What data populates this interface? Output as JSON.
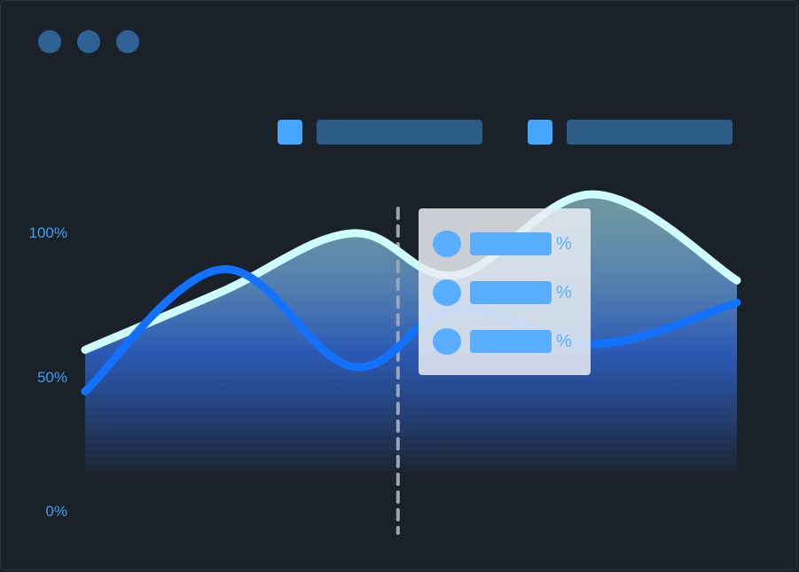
{
  "colors": {
    "background": "#1b2129",
    "window_dots": "#2e6294",
    "legend_swatch": "#46a6ff",
    "legend_bar": "#2b5b87",
    "axis_label": "#3fa0ef",
    "series_light": "#cffcff",
    "series_blue": "#1272ff",
    "tooltip_item": "#5aaeff"
  },
  "window": {
    "dots": [
      "window-dot",
      "window-dot",
      "window-dot"
    ]
  },
  "legend": {
    "items": [
      {
        "swatch": "legend-swatch"
      },
      {
        "swatch": "legend-swatch"
      }
    ]
  },
  "tooltip": {
    "rows": [
      {
        "suffix": "%"
      },
      {
        "suffix": "%"
      },
      {
        "suffix": "%"
      }
    ]
  },
  "chart_data": {
    "type": "area",
    "y_tick_labels": [
      "100%",
      "50%",
      "0%"
    ],
    "y_ticks": [
      100,
      50,
      0
    ],
    "ylim": [
      0,
      100
    ],
    "xlim": [
      0,
      1
    ],
    "grid": false,
    "legend_position": "top-right",
    "hover_x": 0.48,
    "series": [
      {
        "color": "#cffcff",
        "fill": true,
        "x": [
          0,
          0.21,
          0.41,
          0.57,
          0.78,
          1
        ],
        "values": [
          58,
          79,
          100,
          85,
          114,
          83
        ]
      },
      {
        "color": "#1272ff",
        "fill": false,
        "x": [
          0,
          0.21,
          0.41,
          0.57,
          0.78,
          1
        ],
        "values": [
          43,
          87,
          52,
          73,
          60,
          75
        ]
      }
    ]
  }
}
